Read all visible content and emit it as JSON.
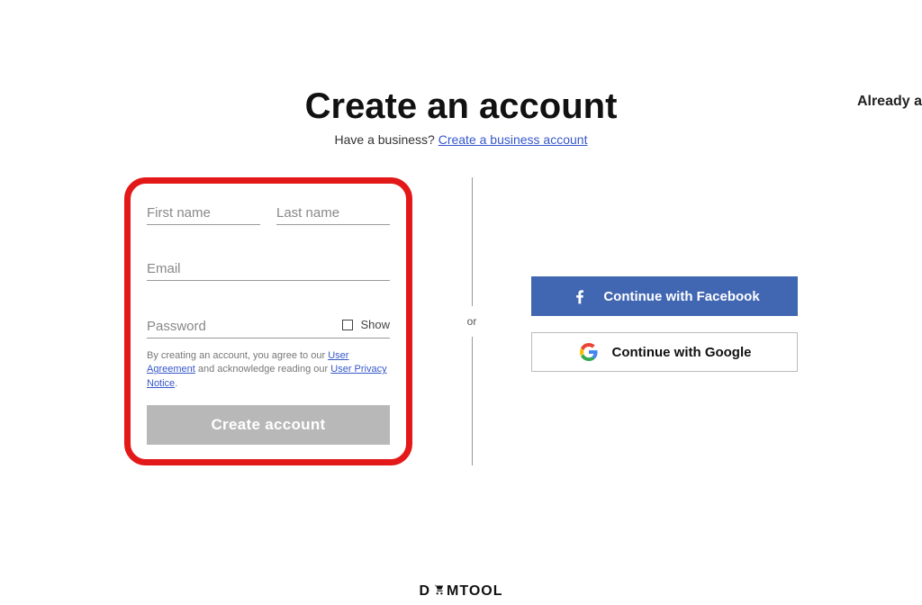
{
  "topbar": {
    "already_text": "Already a"
  },
  "heading": {
    "title": "Create an account",
    "subtitle_prefix": "Have a business? ",
    "subtitle_link": "Create a business account"
  },
  "form": {
    "first_name_placeholder": "First name",
    "last_name_placeholder": "Last name",
    "email_placeholder": "Email",
    "password_placeholder": "Password",
    "show_label": "Show",
    "disclaimer": {
      "p1": "By creating an account, you agree to our ",
      "link1": "User Agreement",
      "p2": " and acknowledge reading our ",
      "link2": "User Privacy Notice",
      "p3": "."
    },
    "create_button": "Create account"
  },
  "divider": {
    "or_label": "or"
  },
  "social": {
    "facebook_label": "Continue with Facebook",
    "google_label": "Continue with Google"
  },
  "watermark": {
    "prefix": "D",
    "suffix": "MTOOL"
  }
}
